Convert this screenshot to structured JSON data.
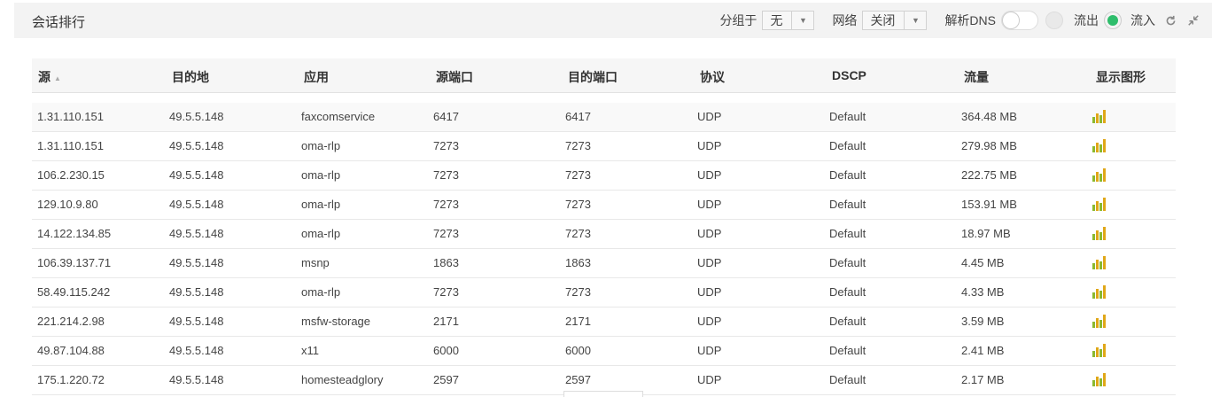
{
  "header": {
    "title": "会话排行",
    "group_label": "分组于",
    "group_value": "无",
    "network_label": "网络",
    "network_value": "关闭",
    "dns_label": "解析DNS",
    "out_label": "流出",
    "in_label": "流入"
  },
  "table": {
    "columns": [
      "源",
      "目的地",
      "应用",
      "源端口",
      "目的端口",
      "协议",
      "DSCP",
      "流量",
      "显示图形"
    ],
    "rows": [
      [
        "1.31.110.151",
        "49.5.5.148",
        "faxcomservice",
        "6417",
        "6417",
        "UDP",
        "Default",
        "364.48 MB"
      ],
      [
        "1.31.110.151",
        "49.5.5.148",
        "oma-rlp",
        "7273",
        "7273",
        "UDP",
        "Default",
        "279.98 MB"
      ],
      [
        "106.2.230.15",
        "49.5.5.148",
        "oma-rlp",
        "7273",
        "7273",
        "UDP",
        "Default",
        "222.75 MB"
      ],
      [
        "129.10.9.80",
        "49.5.5.148",
        "oma-rlp",
        "7273",
        "7273",
        "UDP",
        "Default",
        "153.91 MB"
      ],
      [
        "14.122.134.85",
        "49.5.5.148",
        "oma-rlp",
        "7273",
        "7273",
        "UDP",
        "Default",
        "18.97 MB"
      ],
      [
        "106.39.137.71",
        "49.5.5.148",
        "msnp",
        "1863",
        "1863",
        "UDP",
        "Default",
        "4.45 MB"
      ],
      [
        "58.49.115.242",
        "49.5.5.148",
        "oma-rlp",
        "7273",
        "7273",
        "UDP",
        "Default",
        "4.33 MB"
      ],
      [
        "221.214.2.98",
        "49.5.5.148",
        "msfw-storage",
        "2171",
        "2171",
        "UDP",
        "Default",
        "3.59 MB"
      ],
      [
        "49.87.104.88",
        "49.5.5.148",
        "x11",
        "6000",
        "6000",
        "UDP",
        "Default",
        "2.41 MB"
      ],
      [
        "175.1.220.72",
        "49.5.5.148",
        "homesteadglory",
        "2597",
        "2597",
        "UDP",
        "Default",
        "2.17 MB"
      ]
    ]
  },
  "colors": {
    "accent": "#2ebd6b",
    "graph_green": "#8bb92f",
    "graph_gold": "#e0a718"
  }
}
